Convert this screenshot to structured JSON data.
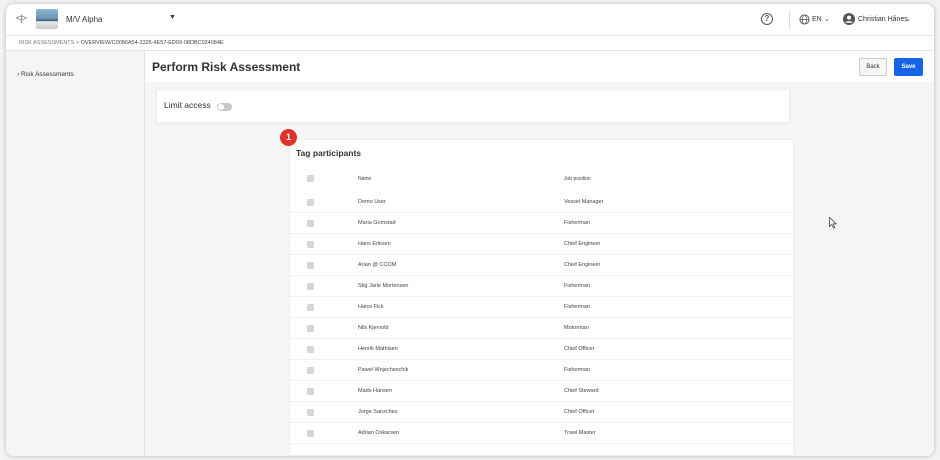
{
  "topbar": {
    "vessel_name": "M/V Alpha",
    "language": "EN",
    "user_name": "Christian Hånes"
  },
  "breadcrumb": {
    "root": "RISK ASSESSMENTS",
    "separator": ">",
    "current": "OVERVIEW/C0086A54-3326-4E57-ED09-08DBC024084E"
  },
  "sidebar": {
    "items": [
      {
        "label": "Risk Assessments"
      }
    ]
  },
  "page": {
    "title": "Perform Risk Assessment",
    "back_label": "Back",
    "save_label": "Save"
  },
  "limit_access": {
    "label": "Limit access",
    "enabled": false
  },
  "tag_participants": {
    "badge": "1",
    "title": "Tag participants",
    "columns": {
      "name": "Name",
      "job": "Job position"
    },
    "rows": [
      {
        "name": "Demo User",
        "job": "Vessel Manager"
      },
      {
        "name": "Maria Grimstad",
        "job": "Fisherman"
      },
      {
        "name": "Hans Eriksen",
        "job": "Chief Engineer"
      },
      {
        "name": "Arian @ CCOM",
        "job": "Chief Engineer"
      },
      {
        "name": "Stig Jarle Mortensen",
        "job": "Fisherman"
      },
      {
        "name": "Hansi Fick",
        "job": "Fisherman"
      },
      {
        "name": "Nils Kjervold",
        "job": "Motorman"
      },
      {
        "name": "Henrik Mathisen",
        "job": "Chief Officer"
      },
      {
        "name": "Pawel Wojecheschik",
        "job": "Fisherman"
      },
      {
        "name": "Mads Hansen",
        "job": "Chief Steward"
      },
      {
        "name": "Jorge Sanzches",
        "job": "Chief Officer"
      },
      {
        "name": "Adrian Oskarsen",
        "job": "Trawl Master"
      }
    ]
  },
  "colors": {
    "accent": "#1565e6",
    "badge": "#e0312b"
  }
}
